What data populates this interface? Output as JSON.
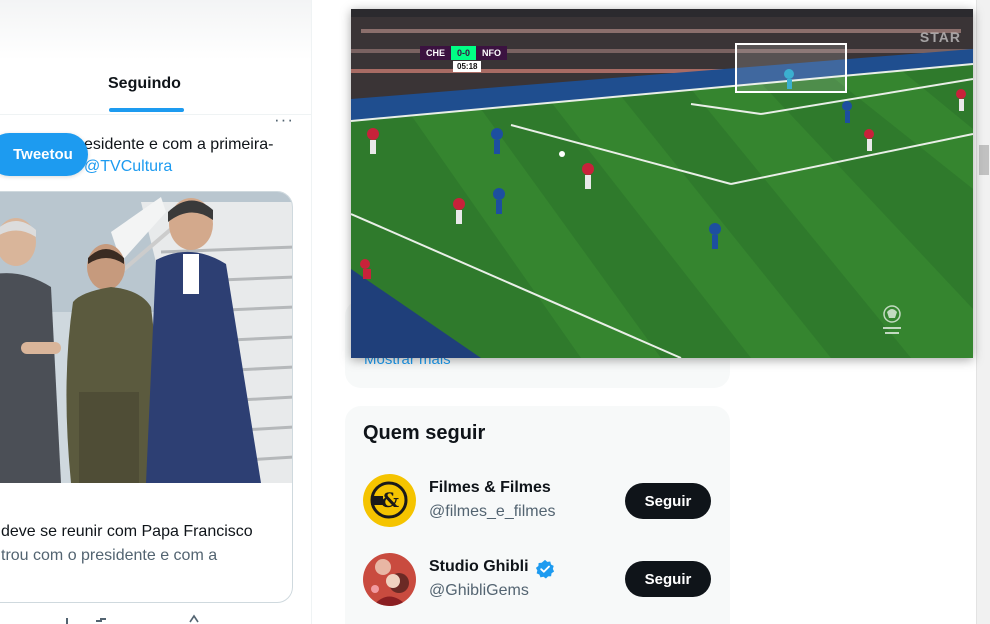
{
  "timeline": {
    "active_tab": "Seguindo",
    "more_glyph": "···",
    "tweeted_toast": "Tweetou",
    "tweet_text_line1": "esidente e com a primeira-",
    "tweet_text_line2": "TVCultura",
    "card_line1": "deve se reunir com Papa Francisco",
    "card_line2": "trou com o presidente e com a"
  },
  "sidebar": {
    "show_more": "Mostrar mais",
    "who_to_follow": {
      "title": "Quem seguir",
      "accounts": [
        {
          "name": "Filmes & Filmes",
          "handle": "@filmes_e_filmes",
          "verified": false,
          "button": "Seguir"
        },
        {
          "name": "Studio Ghibli",
          "handle": "@GhibliGems",
          "verified": true,
          "button": "Seguir"
        }
      ]
    }
  },
  "video_pip": {
    "scorebug": {
      "home": "CHE",
      "score": "0-0",
      "away": "NFO",
      "clock": "05:18"
    },
    "broadcaster": "STAR"
  },
  "colors": {
    "accent": "#1d9bf0",
    "text_primary": "#0f1419",
    "text_secondary": "#536471",
    "panel_bg": "#f7f9f9",
    "follow_button": "#0f1419",
    "pitch_green": "#2f7a2c"
  }
}
